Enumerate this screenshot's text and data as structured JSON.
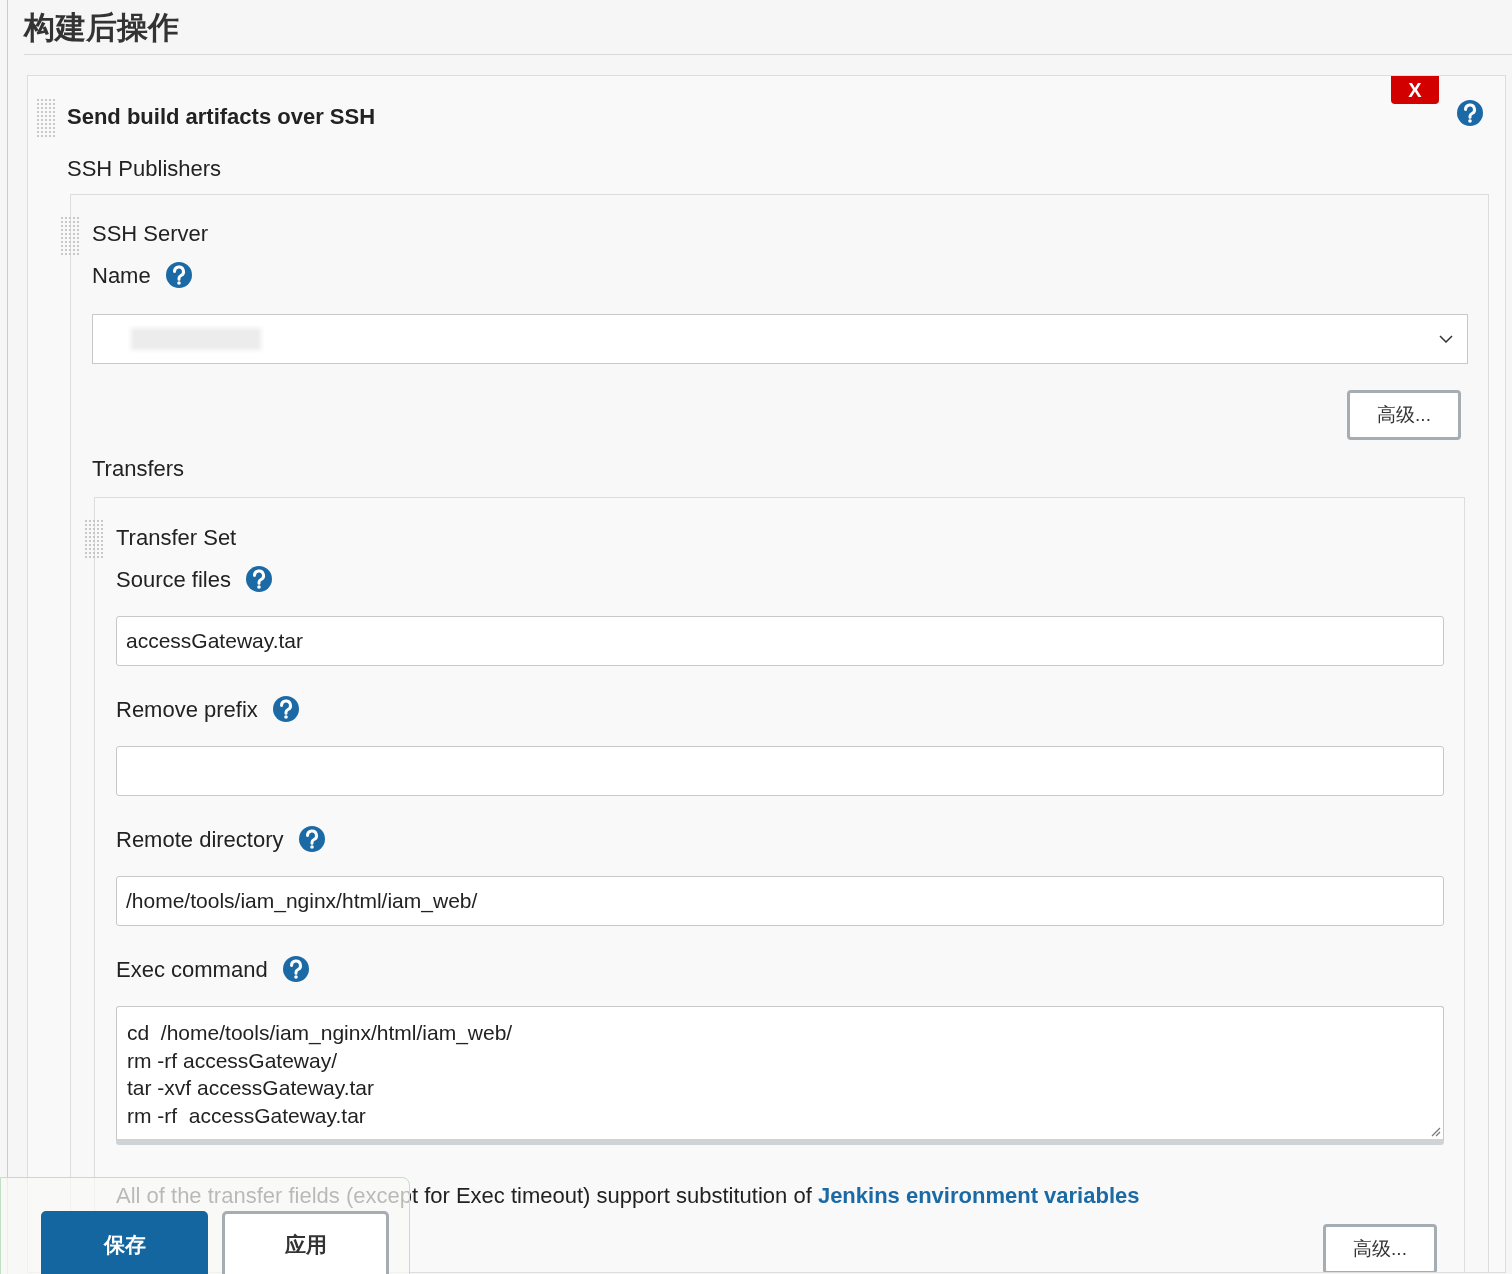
{
  "section_title": "构建后操作",
  "step": {
    "title": "Send build artifacts over SSH",
    "delete_button": "X",
    "publishers_label": "SSH Publishers",
    "server": {
      "title": "SSH Server",
      "name_label": "Name",
      "advanced_button": "高级...",
      "transfers_label": "Transfers",
      "transfer_set": {
        "title": "Transfer Set",
        "fields": [
          {
            "kind": "input",
            "label": "Source files",
            "value": "accessGateway.tar"
          },
          {
            "kind": "input",
            "label": "Remove prefix"
          },
          {
            "kind": "input",
            "label": "Remote directory",
            "value": "/home/tools/iam_nginx/html/iam_web/"
          },
          {
            "kind": "textarea",
            "label": "Exec command",
            "value": "cd  /home/tools/iam_nginx/html/iam_web/\nrm -rf accessGateway/\ntar -xvf accessGateway.tar\nrm -rf  accessGateway.tar"
          }
        ],
        "note": {
          "text": "All of the transfer fields (except for Exec timeout) support substitution of ",
          "link": "Jenkins environment variables"
        },
        "advanced_button": "高级..."
      }
    }
  },
  "bottom_bar": {
    "buttons": [
      {
        "kind": "primary",
        "label": "保存"
      },
      {
        "kind": "secondary",
        "label": "应用"
      }
    ]
  }
}
